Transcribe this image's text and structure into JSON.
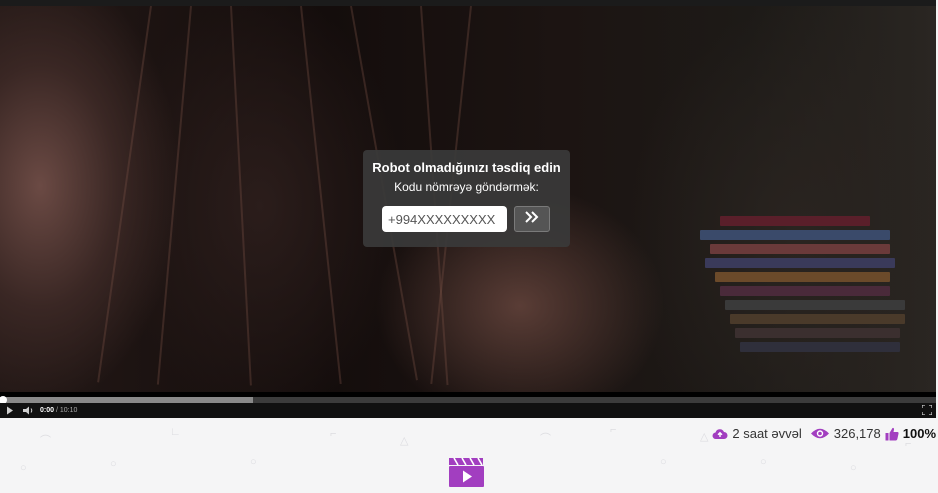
{
  "modal": {
    "title": "Robot olmadığınızı təsdiq edin",
    "subtitle": "Kodu nömrəyə göndərmək:",
    "phone_value": "+994XXXXXXXXX",
    "submit_icon": "double-chevron-right-icon"
  },
  "player": {
    "current_time": "0:00",
    "separator": " / ",
    "duration": "10:10",
    "progress_fraction": 0.27
  },
  "stats": {
    "uploaded": "2 saat əvvəl",
    "views": "326,178",
    "rating": "100%"
  },
  "colors": {
    "accent": "#a23ec0",
    "modal_bg": "#3a3a3a"
  }
}
